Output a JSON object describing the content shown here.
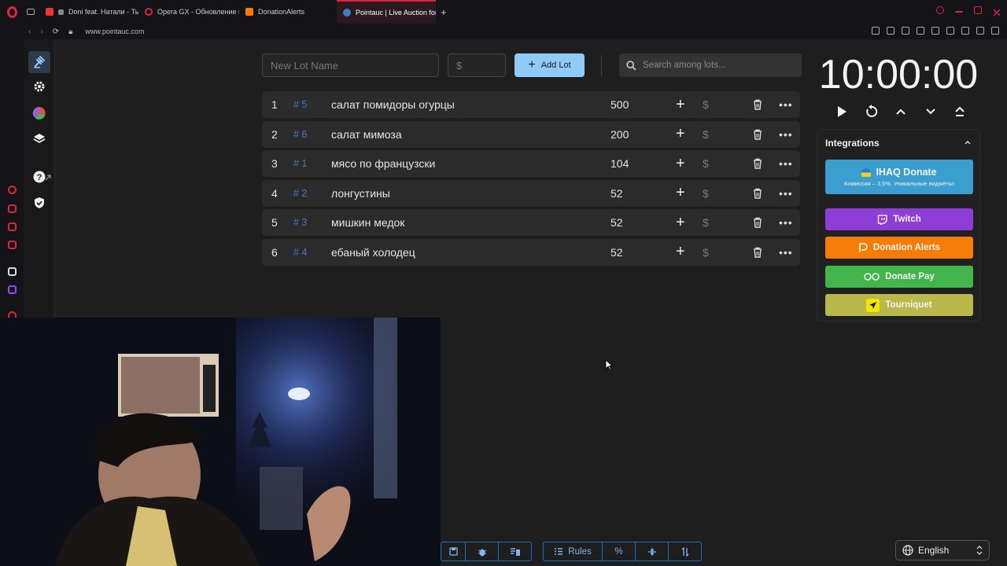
{
  "browser": {
    "tabs": [
      {
        "label": "Doni feat. Натали - Ты",
        "color": "#e53935"
      },
      {
        "label": "Opera GX - Обновление и",
        "color": "#d9273d"
      },
      {
        "label": "DonationAlerts",
        "color": "#f57d07"
      },
      {
        "label": "Pointauc | Live Auction for",
        "color": "#3e7ec7"
      }
    ],
    "url": "www.pointauc.com"
  },
  "toolbar": {
    "lot_name_placeholder": "New Lot Name",
    "amount_placeholder": "$",
    "add_lot_label": "Add Lot",
    "search_placeholder": "Search among lots..."
  },
  "lots": [
    {
      "index": "1",
      "id": "# 5",
      "name": "салат помидоры огурцы",
      "amount": "500"
    },
    {
      "index": "2",
      "id": "# 6",
      "name": "салат мимоза",
      "amount": "200"
    },
    {
      "index": "3",
      "id": "# 1",
      "name": "мясо по французски",
      "amount": "104"
    },
    {
      "index": "4",
      "id": "# 2",
      "name": "лонгустины",
      "amount": "52"
    },
    {
      "index": "5",
      "id": "# 3",
      "name": "мишкин медок",
      "amount": "52"
    },
    {
      "index": "6",
      "id": "# 4",
      "name": "ебаный холодец",
      "amount": "52"
    }
  ],
  "timer": {
    "value": "10:00:00"
  },
  "integrations": {
    "title": "Integrations",
    "ihaq": {
      "label": "IHAQ Donate",
      "sub": "Комиссия – 3,5%. Уникальные виджеты!",
      "color": "#3a9fcf"
    },
    "twitch": {
      "label": "Twitch",
      "color": "#8e3dd6"
    },
    "donation_alerts": {
      "label": "Donation Alerts",
      "color": "#f57d07"
    },
    "donate_pay": {
      "label": "Donate Pay",
      "color": "#43b54c"
    },
    "tourniquet": {
      "label": "Tourniquet",
      "color": "#b9b84a"
    }
  },
  "bottom": {
    "rules_label": "Rules",
    "percent_label": "%"
  },
  "language": {
    "selected": "English"
  }
}
